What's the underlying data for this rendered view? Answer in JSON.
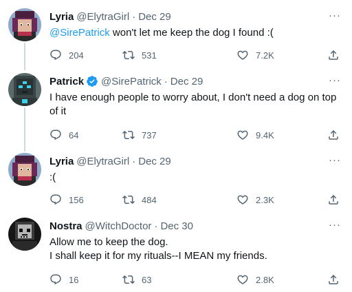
{
  "colors": {
    "accent": "#1d9bf0",
    "muted": "#536471",
    "text": "#0f1419",
    "line": "#cfd9de"
  },
  "more_icon": "more-horizontal-icon",
  "tweets": [
    {
      "name": "Lyria",
      "handle": "@ElytraGirl",
      "date": "Dec 29",
      "mention": "@SirePatrick",
      "text": " won't let me keep the dog I found :(",
      "replies": "204",
      "retweets": "531",
      "likes": "7.2K",
      "more": "···"
    },
    {
      "name": "Patrick",
      "handle": "@SirePatrick",
      "date": "Dec 29",
      "verified_icon": "verified-badge-icon",
      "text": "I have enough people to worry about, I don't need a dog on top of it",
      "replies": "64",
      "retweets": "737",
      "likes": "9.4K",
      "more": "···"
    },
    {
      "name": "Lyria",
      "handle": "@ElytraGirl",
      "date": "Dec 29",
      "text": ":(",
      "replies": "156",
      "retweets": "484",
      "likes": "2.3K",
      "more": "···"
    },
    {
      "name": "Nostra",
      "handle": "@WitchDoctor",
      "date": "Dec 30",
      "text_line1": "Allow me to keep the dog.",
      "text_line2": "I shall keep it for my rituals--I MEAN my friends.",
      "replies": "16",
      "retweets": "63",
      "likes": "2.8K",
      "more": "···"
    }
  ],
  "separator": "·"
}
